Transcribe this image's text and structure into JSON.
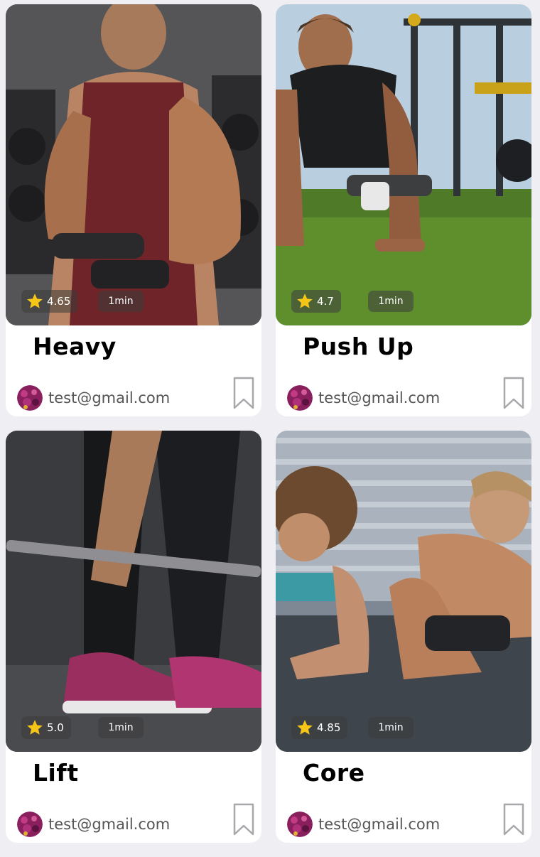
{
  "cards": [
    {
      "title": "Heavy",
      "rating": "4.65",
      "duration": "1min",
      "author": "test@gmail.com"
    },
    {
      "title": "Push Up",
      "rating": "4.7",
      "duration": "1min",
      "author": "test@gmail.com"
    },
    {
      "title": "Lift",
      "rating": "5.0",
      "duration": "1min",
      "author": "test@gmail.com"
    },
    {
      "title": "Core",
      "rating": "4.85",
      "duration": "1min",
      "author": "test@gmail.com"
    }
  ],
  "icons": {
    "rating": "star-icon",
    "save": "bookmark-icon"
  },
  "colors": {
    "background": "#eeeef3",
    "card": "#ffffff",
    "star": "#f5c518",
    "badge": "#3c3c3c"
  }
}
